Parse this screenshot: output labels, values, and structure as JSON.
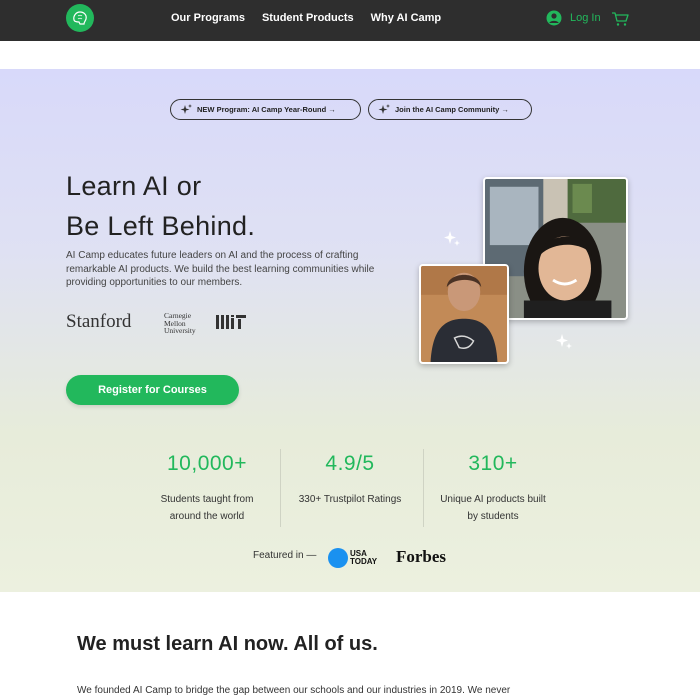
{
  "nav": {
    "logo": "ai-camp-logo",
    "links": [
      "Our Programs",
      "Student Products",
      "Why AI Camp"
    ],
    "login": "Log In",
    "accent": "#22b85c",
    "background": "#2e2e2e"
  },
  "hero": {
    "pills": [
      "NEW Program: AI Camp Year-Round →",
      "Join the AI Camp Community →"
    ],
    "headline_1": "Learn AI or",
    "headline_2": "Be Left Behind.",
    "lead": "AI Camp educates future leaders on AI and the process of crafting remarkable AI products. We build the best learning communities while providing opportunities to our members.",
    "universities": {
      "stanford": "Stanford",
      "cmu": [
        "Carnegie",
        "Mellon",
        "University"
      ],
      "mit": "MIT"
    },
    "register": "Register for Courses"
  },
  "stats": [
    {
      "number": "10,000+",
      "label_1": "Students taught from",
      "label_2": "around the world"
    },
    {
      "number": "4.9/5",
      "label_1": "330+ Trustpilot Ratings",
      "label_2": ""
    },
    {
      "number": "310+",
      "label_1": "Unique AI products built",
      "label_2": "by students"
    }
  ],
  "featured": {
    "label": "Featured in —",
    "usa_today": [
      "USA",
      "TODAY"
    ],
    "forbes": "Forbes"
  },
  "section": {
    "title": "We must learn AI now. All of us.",
    "body": "We founded AI Camp to bridge the gap between our schools and our industries in 2019. We never"
  }
}
